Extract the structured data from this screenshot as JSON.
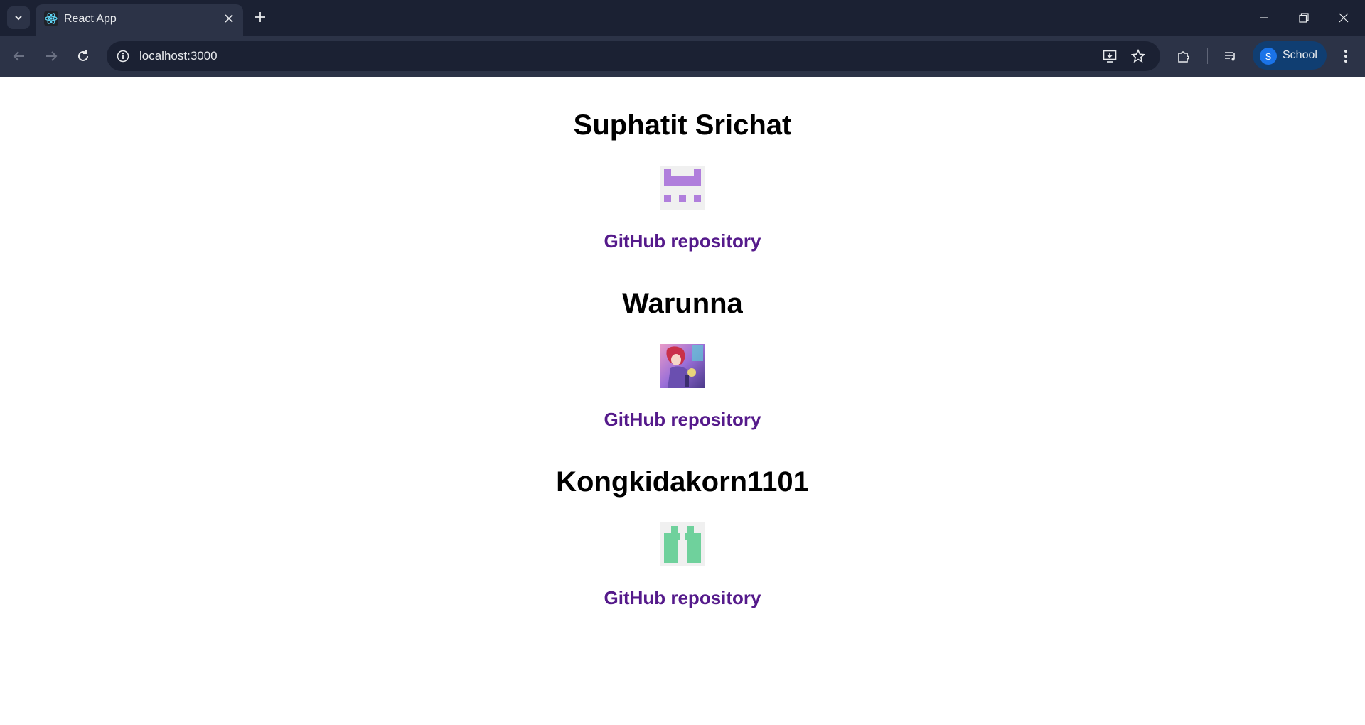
{
  "browser": {
    "tab": {
      "title": "React App",
      "favicon": "react-logo-icon"
    },
    "address_bar": {
      "url": "localhost:3000"
    },
    "profile": {
      "initial": "S",
      "name": "School"
    }
  },
  "page": {
    "users": [
      {
        "name": "Suphatit Srichat",
        "avatar": "purple-identicon",
        "link_label": "GitHub repository",
        "accent": "#b07edc"
      },
      {
        "name": "Warunna",
        "avatar": "anime-character-avatar",
        "link_label": "GitHub repository",
        "accent": "#a06bd6"
      },
      {
        "name": "Kongkidakorn1101",
        "avatar": "green-identicon",
        "link_label": "GitHub repository",
        "accent": "#6fd19c"
      }
    ]
  },
  "colors": {
    "link": "#551a8b",
    "titlebar": "#1b2133",
    "toolbar": "#2c3347"
  }
}
